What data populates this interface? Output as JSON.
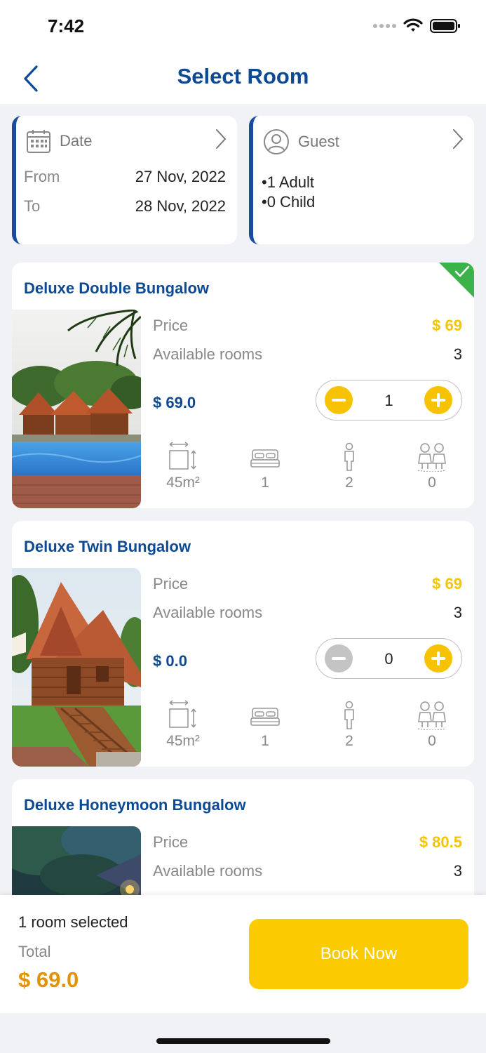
{
  "status_bar": {
    "time": "7:42"
  },
  "nav": {
    "title": "Select Room"
  },
  "date_card": {
    "label": "Date",
    "from_label": "From",
    "from_value": "27 Nov, 2022",
    "to_label": "To",
    "to_value": "28 Nov, 2022"
  },
  "guest_card": {
    "label": "Guest",
    "adults": "•1 Adult",
    "children": "•0 Child"
  },
  "rooms": [
    {
      "name": "Deluxe Double Bungalow",
      "price_label": "Price",
      "price": "$ 69",
      "available_label": "Available rooms",
      "available": "3",
      "subtotal": "$ 69.0",
      "quantity": "1",
      "area": "45m²",
      "beds": "1",
      "adults": "2",
      "children": "0",
      "selected": true
    },
    {
      "name": "Deluxe Twin Bungalow",
      "price_label": "Price",
      "price": "$ 69",
      "available_label": "Available rooms",
      "available": "3",
      "subtotal": "$ 0.0",
      "quantity": "0",
      "area": "45m²",
      "beds": "1",
      "adults": "2",
      "children": "0",
      "selected": false
    },
    {
      "name": "Deluxe Honeymoon Bungalow",
      "price_label": "Price",
      "price": "$ 80.5",
      "available_label": "Available rooms",
      "available": "3"
    }
  ],
  "bottom": {
    "rooms_selected": "1 room selected",
    "total_label": "Total",
    "total_value": "$ 69.0",
    "book_label": "Book Now"
  },
  "colors": {
    "primary": "#0d4a96",
    "accent": "#fcca00",
    "price": "#f5c400",
    "total": "#e39300",
    "selected": "#3cb24a"
  }
}
